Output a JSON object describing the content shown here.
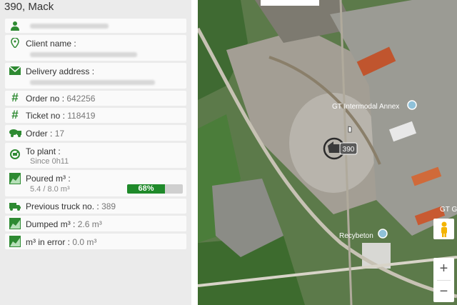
{
  "vehicle": {
    "title": "390, Mack"
  },
  "fields": {
    "client_name_label": "Client name :",
    "delivery_label": "Delivery address :",
    "order_no_label": "Order no :",
    "order_no_value": "642256",
    "ticket_no_label": "Ticket no :",
    "ticket_no_value": "118419",
    "order_label": "Order :",
    "order_value": "17",
    "to_plant_label": "To plant :",
    "to_plant_value": "Since 0h11",
    "poured_label": "Poured m³ :",
    "poured_value": "5.4 / 8.0 m³",
    "poured_percent_text": "68%",
    "poured_fraction": 0.68,
    "prev_truck_label": "Previous truck no. :",
    "prev_truck_value": "389",
    "dumped_label": "Dumped m³ :",
    "dumped_value": "2.6 m³",
    "error_label": "m³ in error :",
    "error_value": "0.0 m³"
  },
  "map": {
    "label_annex": "GT Intermodal Annex",
    "label_recyb": "Recybeton",
    "label_edge": "GT G",
    "truck_label": "390",
    "zoom_in": "+",
    "zoom_out": "−"
  },
  "colors": {
    "accent": "#2e8a32",
    "progress": "#1f8a2a"
  },
  "icons": [
    "person-icon",
    "location-pin-icon",
    "envelope-icon",
    "hash-icon",
    "truck-icon",
    "refresh-icon",
    "area-chart-icon",
    "pegman-icon"
  ]
}
